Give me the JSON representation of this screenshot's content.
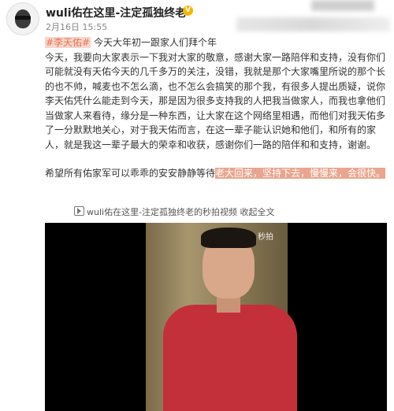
{
  "post": {
    "username": "wuli佑在这里-注定孤独终老",
    "verified_badge": "V",
    "meta": "2月16日 15:55",
    "title_topic": "#李天佑#",
    "title_text": "今天大年初一跟家人们拜个年",
    "paragraph1": "今天，我要向大家表示一下我对大家的敬意，感谢大家一路陪伴和支持，没有你们可能就没有天佑今天的几千多万的关注，没错，我就是那个大家嘴里所说的那个长的也不帅，喊麦也不怎么滴，也不怎么会搞笑的那个我，有很多人提出质疑，说你李天佑凭什么能走到今天，那是因为很多支持我的人把我当做家人，而我也拿他们当做家人来看待，缘分是一种东西，让大家在这个网络里相遇，而他们对我天佑多了一分默默地关心，对于我天佑而言，在这一辈子能认识她和他们，和所有的家人，就是我这一辈子最大的荣幸和收获，感谢你们一路的陪伴和和支持，谢谢。",
    "paragraph2_plain": "希望所有佑家军可以乖乖的安安静静等待",
    "paragraph2_highlight": "老大回来，坚持下去，慢慢来，会很快。",
    "video_link": "wuli佑在这里-注定孤独终老的秒拍视频 收起全文",
    "video_overlay": "秒拍"
  },
  "icons": {
    "avatar": "avatar-icon",
    "verified": "verified-badge-icon",
    "video": "video-play-icon"
  },
  "colors": {
    "topic": "#eb7350",
    "highlight": "#e9a58d",
    "verified": "#f7b500"
  }
}
